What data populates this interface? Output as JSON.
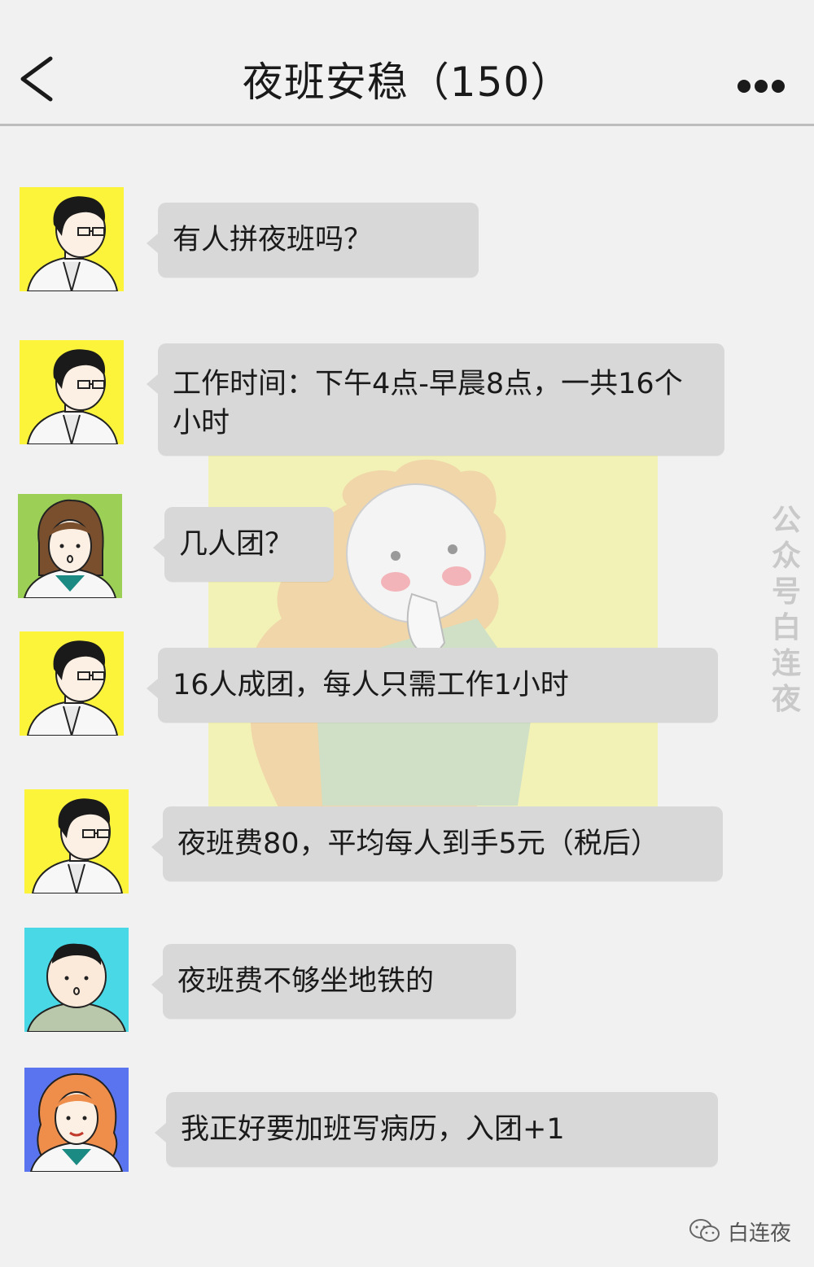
{
  "header": {
    "title": "夜班安稳（150）",
    "back_icon": "chevron-left-icon",
    "more_icon": "more-dots-icon"
  },
  "messages": [
    {
      "avatar": "doctor-male-glasses-yellow",
      "text": "有人拼夜班吗？"
    },
    {
      "avatar": "doctor-male-glasses-yellow",
      "text": "工作时间：下午4点-早晨8点，一共16个小时"
    },
    {
      "avatar": "doctor-female-green",
      "text": "几人团？"
    },
    {
      "avatar": "doctor-male-glasses-yellow",
      "text": "16人成团，每人只需工作1小时"
    },
    {
      "avatar": "doctor-male-glasses-yellow",
      "text": "夜班费80，平均每人到手5元（税后）"
    },
    {
      "avatar": "man-cyan",
      "text": "夜班费不够坐地铁的"
    },
    {
      "avatar": "doctor-female-curly-blue",
      "text": "我正好要加班写病历，入团+1"
    }
  ],
  "watermark": {
    "side_chars": [
      "公",
      "众",
      "号",
      "白",
      "连",
      "夜"
    ],
    "bottom_label": "白连夜"
  },
  "colors": {
    "background": "#f1f1f1",
    "bubble": "#d8d8d8",
    "avatar_yellow": "#fbf43a",
    "avatar_green": "#9bcf55",
    "avatar_cyan": "#48d8e6",
    "avatar_blue": "#5a74ef"
  }
}
